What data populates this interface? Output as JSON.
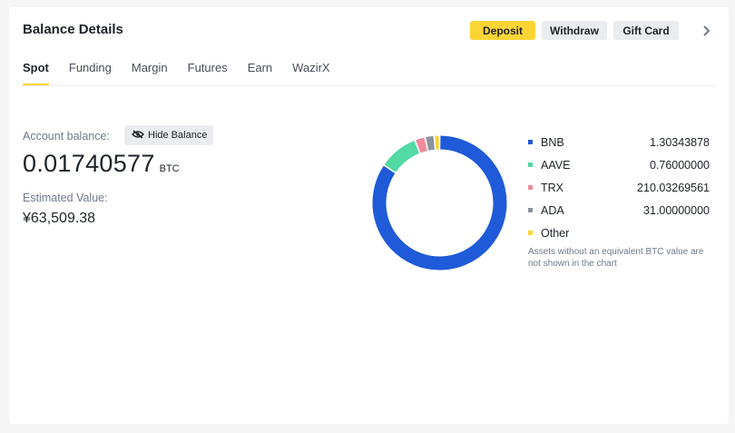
{
  "header": {
    "title": "Balance Details",
    "deposit_label": "Deposit",
    "withdraw_label": "Withdraw",
    "giftcard_label": "Gift Card"
  },
  "tabs": [
    {
      "label": "Spot",
      "active": true
    },
    {
      "label": "Funding",
      "active": false
    },
    {
      "label": "Margin",
      "active": false
    },
    {
      "label": "Futures",
      "active": false
    },
    {
      "label": "Earn",
      "active": false
    },
    {
      "label": "WazirX",
      "active": false
    }
  ],
  "account": {
    "balance_label": "Account balance:",
    "hide_label": "Hide Balance",
    "balance": "0.01740577",
    "unit": "BTC",
    "estimated_label": "Estimated Value:",
    "estimated_value": "¥63,509.38"
  },
  "colors": {
    "accent": "#fcd535",
    "BNB": "#1f5bd8",
    "AAVE": "#52d9a4",
    "TRX": "#f08b99",
    "ADA": "#8a939f",
    "Other": "#fcd535"
  },
  "chart_data": {
    "type": "pie",
    "style": "donut",
    "series": [
      {
        "name": "BNB",
        "value": 84.5
      },
      {
        "name": "AAVE",
        "value": 9.5
      },
      {
        "name": "TRX",
        "value": 2.5
      },
      {
        "name": "ADA",
        "value": 2.2
      },
      {
        "name": "Other",
        "value": 1.3
      }
    ]
  },
  "legend": {
    "items": [
      {
        "name": "BNB",
        "value": "1.30343878"
      },
      {
        "name": "AAVE",
        "value": "0.76000000"
      },
      {
        "name": "TRX",
        "value": "210.03269561"
      },
      {
        "name": "ADA",
        "value": "31.00000000"
      },
      {
        "name": "Other",
        "value": ""
      }
    ],
    "note": "Assets without an equivalent BTC value are not shown in the chart"
  }
}
